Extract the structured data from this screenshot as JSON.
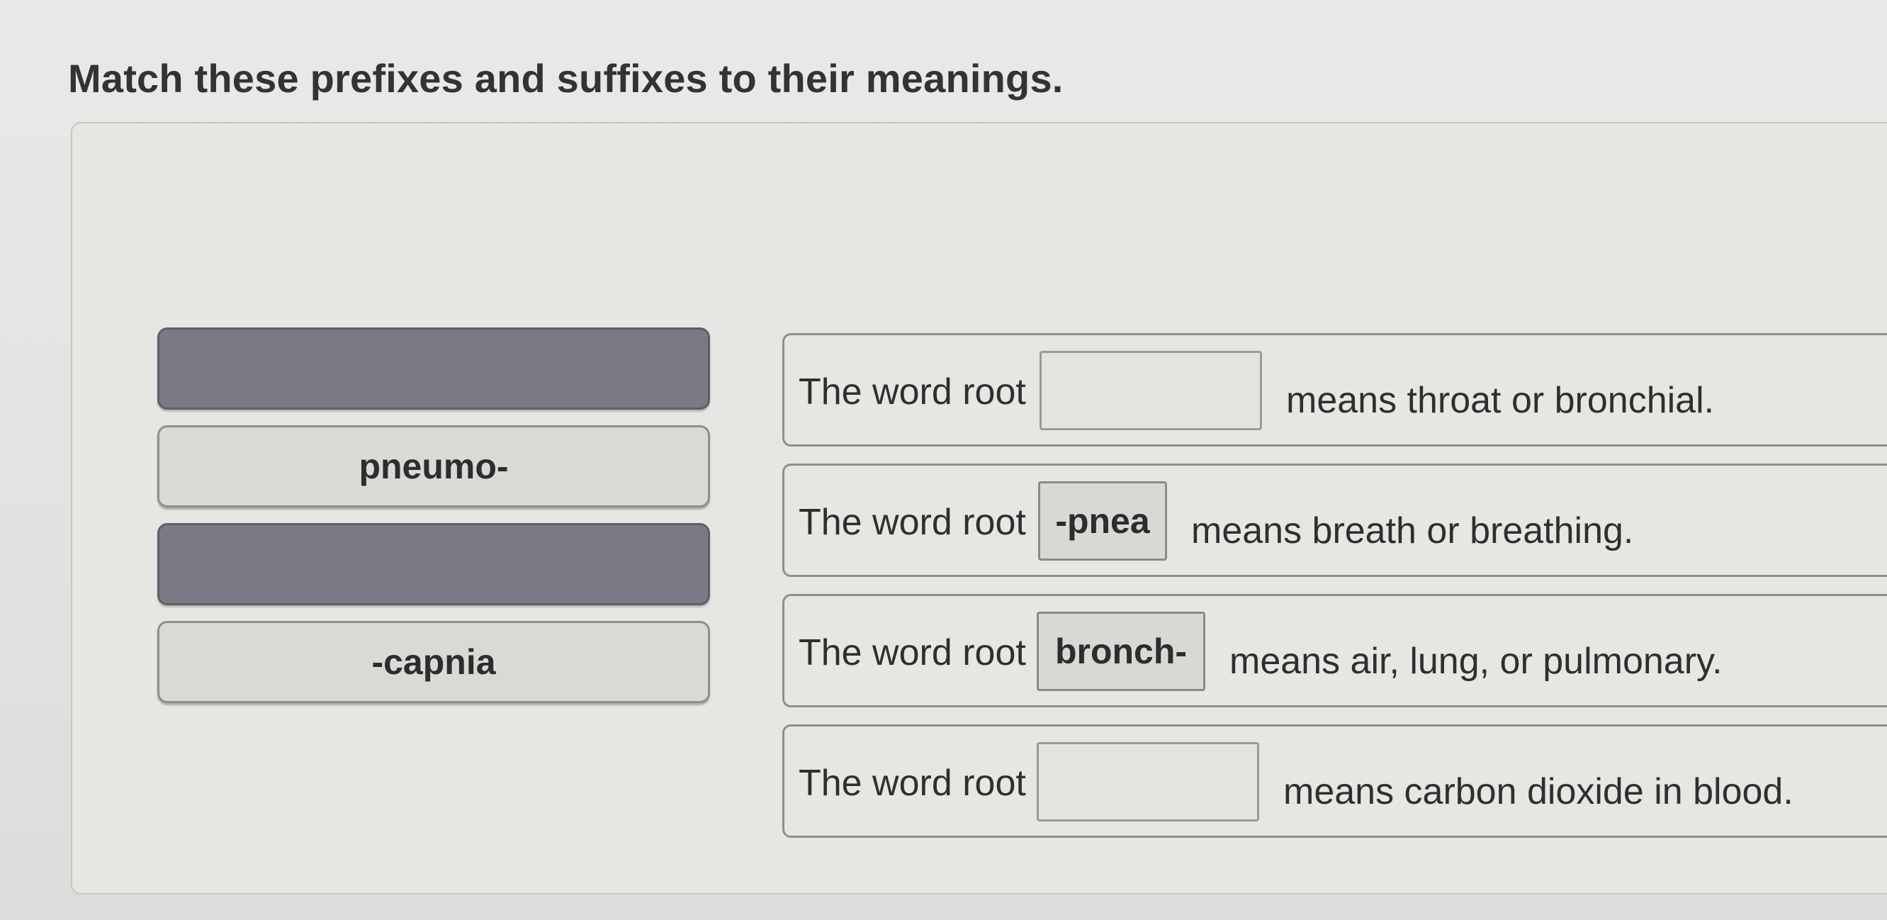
{
  "question": {
    "title": "Match these prefixes and suffixes to their meanings."
  },
  "answer_bank": [
    {
      "label": "",
      "state": "used"
    },
    {
      "label": "pneumo-",
      "state": "available"
    },
    {
      "label": "",
      "state": "used"
    },
    {
      "label": "-capnia",
      "state": "available"
    }
  ],
  "statements": [
    {
      "prefix": "The word root",
      "answer": "",
      "meaning": "means throat or bronchial."
    },
    {
      "prefix": "The word root",
      "answer": "-pnea",
      "meaning": "means breath or breathing."
    },
    {
      "prefix": "The word root",
      "answer": "bronch-",
      "meaning": "means air, lung, or pulmonary."
    },
    {
      "prefix": "The word root",
      "answer": "",
      "meaning": "means carbon dioxide in blood."
    }
  ],
  "colors": {
    "tile_available": "#d9d9d6",
    "tile_used": "#7a7a84",
    "border": "#8e8e8e"
  }
}
